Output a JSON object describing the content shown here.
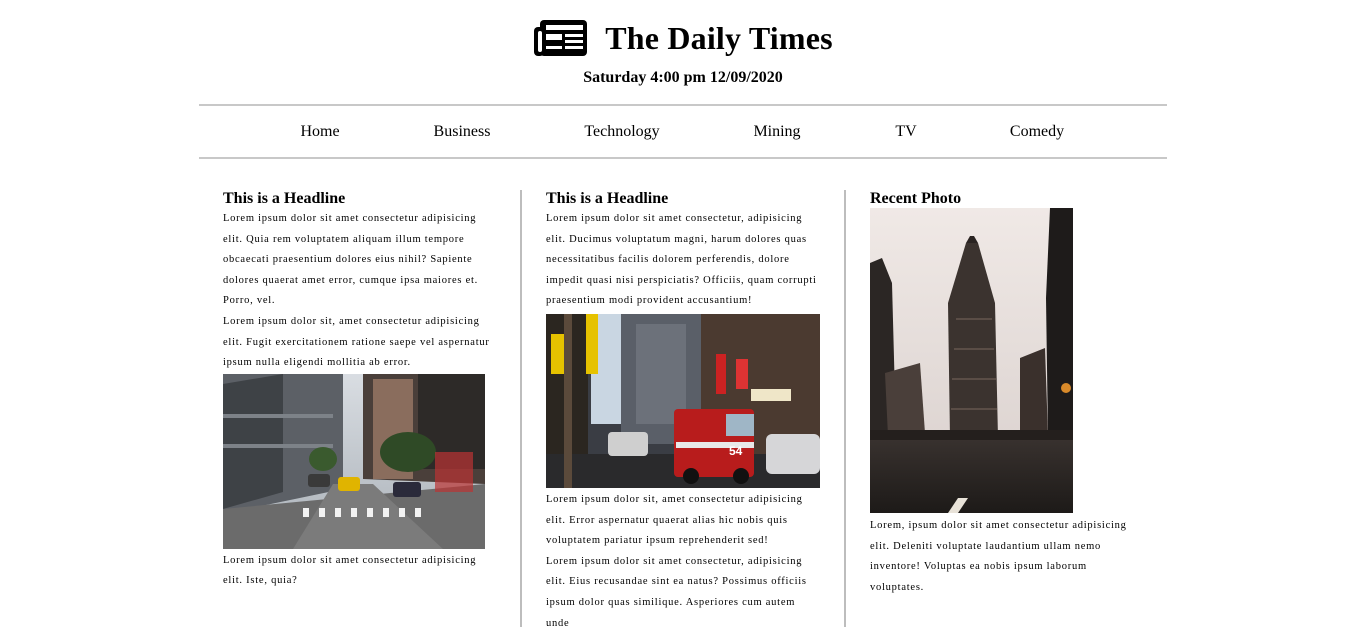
{
  "header": {
    "logo_icon": "newspaper-icon",
    "title": "The Daily Times",
    "dateline": "Saturday 4:00 pm 12/09/2020"
  },
  "nav": {
    "items": [
      "Home",
      "Business",
      "Technology",
      "Mining",
      "TV",
      "Comedy"
    ]
  },
  "columns": [
    {
      "headline": "This is a Headline",
      "paragraphs": [
        "Lorem ipsum dolor sit amet consectetur adipisicing elit. Quia rem voluptatem aliquam illum tempore obcaecati praesentium dolores eius nihil? Sapiente dolores quaerat amet error, cumque ipsa maiores et. Porro, vel.",
        "Lorem ipsum dolor sit, amet consectetur adipisicing elit. Fugit exercitationem ratione saepe vel aspernatur ipsum nulla eligendi mollitia ab error."
      ],
      "after_image": "Lorem ipsum dolor sit amet consectetur adipisicing elit. Iste, quia?"
    },
    {
      "headline": "This is a Headline",
      "paragraphs": [
        "Lorem ipsum dolor sit amet consectetur, adipisicing elit. Ducimus voluptatum magni, harum dolores quas necessitatibus facilis dolorem perferendis, dolore impedit quasi nisi perspiciatis? Officiis, quam corrupti praesentium modi provident accusantium!"
      ],
      "after_image": [
        "Lorem ipsum dolor sit, amet consectetur adipisicing elit. Error aspernatur quaerat alias hic nobis quis voluptatem pariatur ipsum reprehenderit sed!",
        "Lorem ipsum dolor sit amet consectetur, adipisicing elit. Eius recusandae sint ea natus? Possimus officiis ipsum dolor quas similique. Asperiores cum autem unde"
      ]
    },
    {
      "headline": "Recent Photo",
      "after_image": "Lorem, ipsum dolor sit amet consectetur adipisicing elit. Deleniti voluptate laudantium ullam nemo inventore! Voluptas ea nobis ipsum laborum voluptates."
    }
  ],
  "colors": {
    "text": "#000000",
    "rule": "#c8c8c8",
    "column_divider": "#bdbdbd"
  }
}
